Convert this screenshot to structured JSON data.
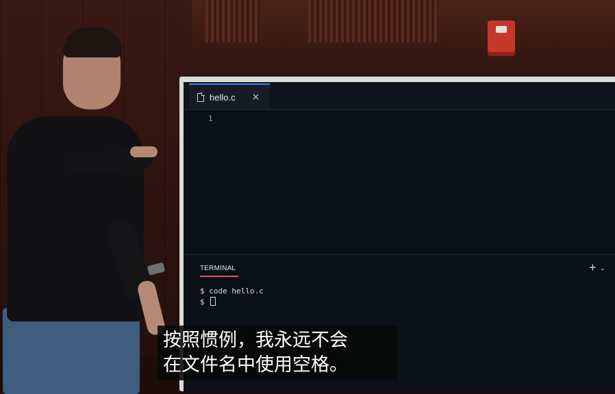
{
  "editor": {
    "tab": {
      "filename": "hello.c",
      "close_symbol": "×",
      "icon": "file-icon"
    },
    "line_numbers": [
      "1"
    ]
  },
  "terminal": {
    "title": "TERMINAL",
    "actions": {
      "add_symbol": "+",
      "dropdown_symbol": "⌄"
    },
    "lines": [
      "$ code hello.c",
      "$ "
    ]
  },
  "subtitle": {
    "lines": [
      "按照惯例，我永远不会",
      "在文件名中使用空格。"
    ]
  },
  "colors": {
    "screen_bg": "#0d1118",
    "tab_accent": "#3b82f6",
    "terminal_underline": "#e05a5a",
    "alarm": "#c7372c"
  }
}
